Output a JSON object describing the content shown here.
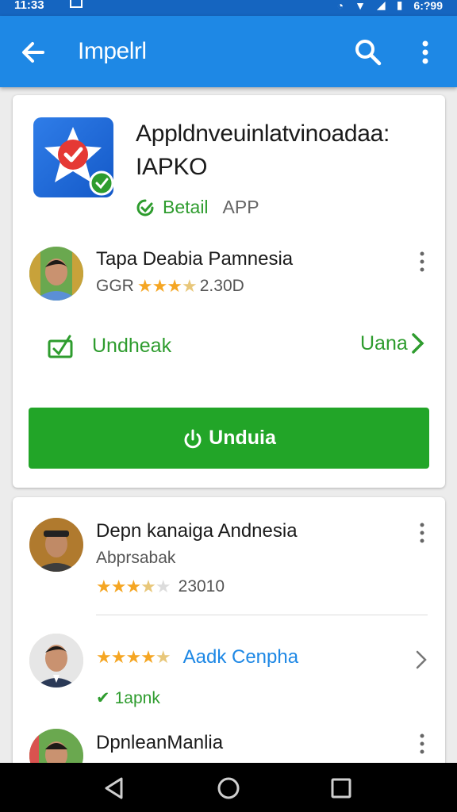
{
  "status_bar": {
    "time": "11:33",
    "clock": "6:?99"
  },
  "app_bar": {
    "title": "Impelrl"
  },
  "app_card": {
    "name_line1": "Appldnveuinlatvinoadaa:",
    "name_line2": "IAPKO",
    "detail_label": "Betail",
    "app_tag": "APP",
    "developer": {
      "name": "Tapa Deabia Pamnesia",
      "rating_prefix": "GGR",
      "rating_count": "2.30D",
      "rating": 3.5
    },
    "unlock_label": "Undheak",
    "next_label": "Uana",
    "download_label": "Unduia"
  },
  "reviews": [
    {
      "name": "Depn kanaiga Andnesia",
      "subtitle": "Abprsabak",
      "rating": 3.5,
      "count": "23010"
    },
    {
      "link_text": "Aadk Cenpha",
      "rating": 4.5,
      "verified_label": "1apnk"
    },
    {
      "name": "DpnleanManlia"
    }
  ],
  "colors": {
    "primary": "#1e88e5",
    "primary_dark": "#1565c0",
    "accent_green": "#22a528",
    "star": "#f5a623"
  },
  "icons": [
    "back-arrow-icon",
    "search-icon",
    "more-vert-icon",
    "check-badge-icon",
    "unlock-icon",
    "chevron-right-icon",
    "power-icon",
    "star-icon",
    "checkmark-icon",
    "nav-back-icon",
    "nav-home-icon",
    "nav-recents-icon"
  ]
}
